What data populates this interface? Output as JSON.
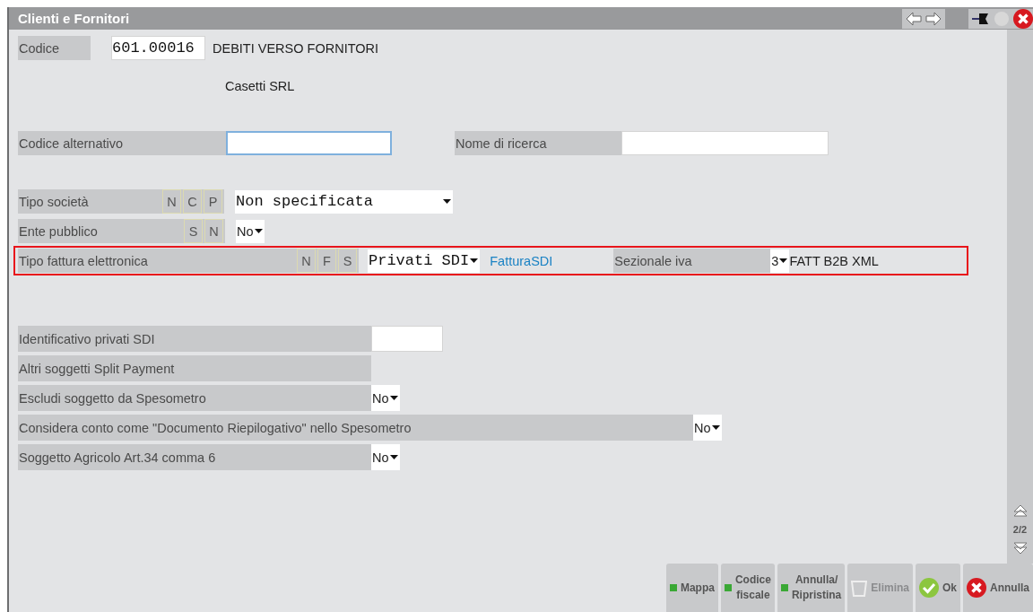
{
  "window": {
    "title": "Clienti e Fornitori"
  },
  "codice": {
    "label": "Codice",
    "value": "601.00016",
    "description": "DEBITI VERSO FORNITORI",
    "name": "Casetti SRL"
  },
  "codice_alternativo": {
    "label": "Codice alternativo",
    "focused": true
  },
  "nome_di_ricerca": {
    "label": "Nome di ricerca"
  },
  "options": [
    {
      "label": "Tipo società",
      "keys": [
        "N",
        "C",
        "P"
      ],
      "value": "Non specificata",
      "highlighted": false
    },
    {
      "label": "Ente pubblico",
      "keys": [
        "S",
        "N"
      ],
      "value": "No",
      "highlighted": false
    },
    {
      "label": "Tipo fattura elettronica",
      "keys": [
        "N",
        "F",
        "S"
      ],
      "value": "Privati SDI",
      "highlighted": true,
      "link": "FatturaSDI",
      "extra_label": "Sezionale iva",
      "extra_value": "3",
      "extra_text": "FATT B2B XML"
    }
  ],
  "fields": [
    {
      "kind": "input",
      "label": "Identificativo privati SDI"
    },
    {
      "kind": "none",
      "label": "Altri soggetti Split Payment"
    },
    {
      "kind": "select",
      "label": "Escludi soggetto da Spesometro",
      "value": "No"
    },
    {
      "kind": "select",
      "label": "Considera conto come \"Documento Riepilogativo\" nello Spesometro",
      "value": "No"
    },
    {
      "kind": "select",
      "label": "Soggetto Agricolo Art.34 comma 6",
      "value": "No"
    }
  ],
  "page": "2/2",
  "buttons": [
    {
      "kind": "green",
      "lines": [
        "Mappa"
      ],
      "disabled": false
    },
    {
      "kind": "green",
      "lines": [
        "Codice",
        "fiscale"
      ],
      "disabled": false
    },
    {
      "kind": "green",
      "lines": [
        "Annulla/",
        "Ripristina"
      ],
      "disabled": false
    },
    {
      "kind": "trash",
      "lines": [
        "Elimina"
      ],
      "disabled": true
    },
    {
      "kind": "ok",
      "lines": [
        "Ok"
      ],
      "disabled": false
    },
    {
      "kind": "cancel",
      "lines": [
        "Annulla"
      ],
      "disabled": false
    }
  ]
}
